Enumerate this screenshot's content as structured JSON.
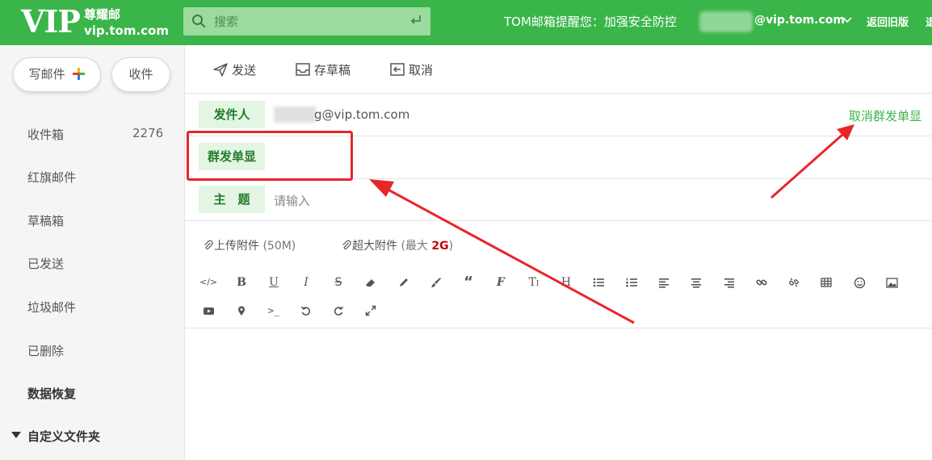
{
  "header": {
    "logo_vip": "VIP",
    "logo_line1": "尊耀邮",
    "logo_line2": "vip.tom.com",
    "search_placeholder": "搜索",
    "tip": "TOM邮箱提醒您：加强安全防控",
    "account_suffix": "@vip.tom.com",
    "old_version": "返回旧版",
    "cut_text": "退"
  },
  "sidebar": {
    "compose": "写邮件",
    "receive": "收件",
    "items": [
      {
        "label": "收件箱",
        "count": "2276"
      },
      {
        "label": "红旗邮件"
      },
      {
        "label": "草稿箱"
      },
      {
        "label": "已发送"
      },
      {
        "label": "垃圾邮件"
      },
      {
        "label": "已删除"
      },
      {
        "label": "数据恢复"
      },
      {
        "label": "自定义文件夹"
      }
    ]
  },
  "toolbar": {
    "send": "发送",
    "save_draft": "存草稿",
    "cancel": "取消"
  },
  "compose": {
    "sender_label": "发件人",
    "sender_value": "g@vip.tom.com",
    "cancel_group": "取消群发单显",
    "group_label": "群发单显",
    "subject_label": "主　题",
    "subject_placeholder": "请输入",
    "upload_attach": "上传附件",
    "upload_limit": "(50M)",
    "large_attach": "超大附件",
    "large_prefix": "(最大",
    "large_size": "2G",
    "large_suffix": ")"
  },
  "colors": {
    "brand_green": "#3ab54a",
    "label_bg": "#e3f5e3",
    "annotation_red": "#e8262a"
  }
}
